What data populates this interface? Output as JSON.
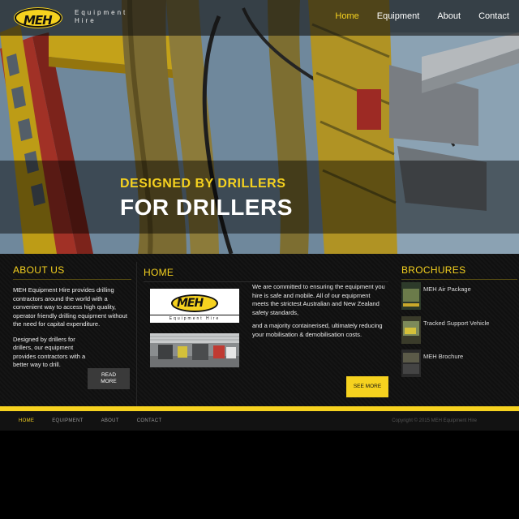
{
  "header": {
    "logo_mark": "MEH",
    "logo_sub_line1": "Equipment",
    "logo_sub_line2": "Hire",
    "nav": [
      {
        "label": "Home",
        "active": true
      },
      {
        "label": "Equipment",
        "active": false
      },
      {
        "label": "About",
        "active": false
      },
      {
        "label": "Contact",
        "active": false
      }
    ]
  },
  "hero": {
    "line1": "DESIGNED BY DRILLERS",
    "line2": "FOR DRILLERS"
  },
  "about": {
    "title": "ABOUT US",
    "p1": "MEH Equipment Hire provides drilling contractors around the world with a convenient way to access high quality, operator friendly drilling equipment without the need for capital expenditure.",
    "p2": "Designed by drillers for drillers, our equipment provides contractors with a better way to drill.",
    "read_more_line1": "READ",
    "read_more_line2": "MORE"
  },
  "home": {
    "title": "HOME",
    "card_logo": "MEH",
    "card_sub": "Equipment Hire",
    "p1": "We are committed to ensuring the equipment you hire is safe and mobile. All of our equipment meets the strictest Australian and New Zealand safety standards,",
    "p2": "and a majority containerised, ultimately reducing your mobilisation & demobilisation costs.",
    "see_more": "SEE MORE"
  },
  "brochures": {
    "title": "BROCHURES",
    "items": [
      {
        "label": "MEH Air Package"
      },
      {
        "label": "Tracked Support Vehicle"
      },
      {
        "label": "MEH Brochure"
      }
    ]
  },
  "footer": {
    "nav": [
      {
        "label": "HOME",
        "active": true
      },
      {
        "label": "EQUIPMENT",
        "active": false
      },
      {
        "label": "ABOUT",
        "active": false
      },
      {
        "label": "CONTACT",
        "active": false
      }
    ],
    "copyright": "Copyright © 2015 MEH Equipment Hire"
  },
  "colors": {
    "accent": "#f6d21f",
    "background": "#000000",
    "panel": "#121212"
  }
}
